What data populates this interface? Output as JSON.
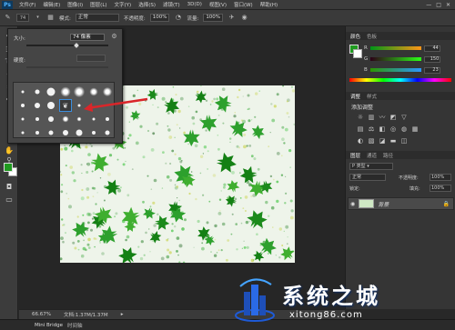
{
  "app": {
    "logo": "Ps"
  },
  "menu": [
    "文件(F)",
    "编辑(E)",
    "图像(I)",
    "图层(L)",
    "文字(Y)",
    "选择(S)",
    "滤镜(T)",
    "3D(D)",
    "视图(V)",
    "窗口(W)",
    "帮助(H)"
  ],
  "window_controls": [
    "—",
    "□",
    "✕"
  ],
  "options_bar": {
    "brush_size": "74",
    "mode_label": "模式:",
    "mode_value": "正常",
    "opacity_label": "不透明度:",
    "opacity_value": "100%",
    "flow_label": "流量:",
    "flow_value": "100%"
  },
  "brush_popup": {
    "size_label": "大小:",
    "size_value": "74 像素",
    "hardness_label": "硬度:",
    "size_fraction": 0.62
  },
  "colors": {
    "foreground": "#1f9a1f",
    "background": "#ffffff",
    "arrow": "#d9262a",
    "accent": "#3b8fe0"
  },
  "right_panels": {
    "color_tabs": [
      "颜色",
      "色板"
    ],
    "rgb": [
      {
        "channel": "R",
        "value": "44",
        "fraction": 0.17
      },
      {
        "channel": "G",
        "value": "150",
        "fraction": 0.59
      },
      {
        "channel": "B",
        "value": "23",
        "fraction": 0.09
      }
    ],
    "adjust_tabs": [
      "调整",
      "样式"
    ],
    "adjust_title": "添加调整",
    "layers_tabs": [
      "图层",
      "通道",
      "路径"
    ],
    "blend_mode": "正常",
    "layer_opacity_label": "不透明度:",
    "layer_opacity_value": "100%",
    "fill_label": "填充:",
    "fill_value": "100%",
    "lock_label": "锁定:",
    "layer_name": "背景"
  },
  "status": {
    "zoom": "66.67%",
    "doc": "文档:1.37M/1.37M"
  },
  "bottom_tabs": [
    "Mini Bridge",
    "时间轴"
  ],
  "watermark": {
    "title": "系统之城",
    "url": "xitong86.com"
  }
}
